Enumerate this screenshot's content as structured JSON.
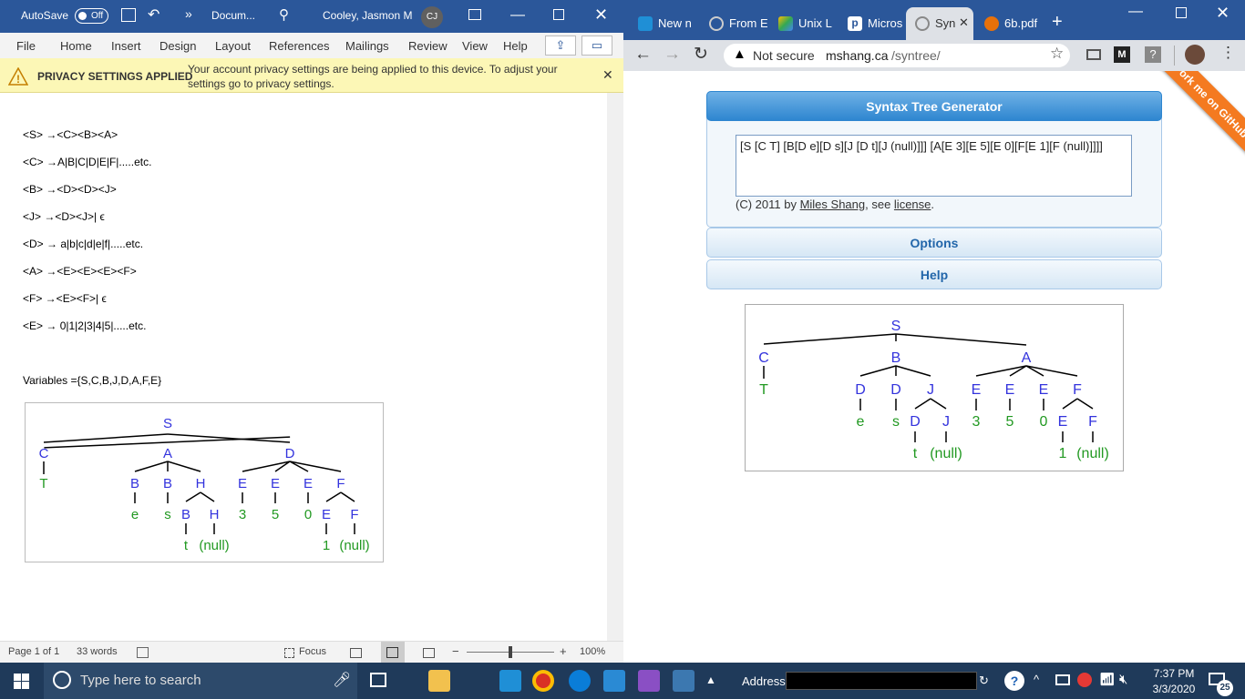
{
  "word": {
    "autosave_label": "AutoSave",
    "autosave_state": "Off",
    "doc_title": "Docum...",
    "user_name": "Cooley, Jasmon M",
    "user_initials": "CJ",
    "menu": [
      "File",
      "Home",
      "Insert",
      "Design",
      "Layout",
      "References",
      "Mailings",
      "Review",
      "View",
      "Help"
    ],
    "privacy_title": "PRIVACY SETTINGS APPLIED",
    "privacy_line1": "Your account privacy settings are being applied to this device. To adjust your",
    "privacy_line2": "settings go to privacy settings.",
    "grammar": [
      "<S> →<C><B><A>",
      "<C> →A|B|C|D|E|F|.....etc.",
      "<B> →<D><D><J>",
      "<J> →<D><J>| ϵ",
      "<D> → a|b|c|d|e|f|.....etc.",
      "<A> →<E><E><E><F>",
      "<F> →<E><F>| ϵ",
      "<E> → 0|1|2|3|4|5|.....etc."
    ],
    "variables": "Variables ={S,C,B,J,D,A,F,E}",
    "tree": {
      "root": "S",
      "level1": [
        "C",
        "A",
        "D"
      ],
      "c_child": "T",
      "a_children": [
        "B",
        "B",
        "H"
      ],
      "d_children": [
        "E",
        "E",
        "E",
        "F"
      ],
      "b_leaves": [
        "e",
        "s"
      ],
      "h_children": [
        "B",
        "H"
      ],
      "e_leaves": [
        "3",
        "5",
        "0"
      ],
      "f_children": [
        "E",
        "F"
      ],
      "deep_leaves": [
        "t",
        "(null)",
        "1",
        "(null)"
      ]
    },
    "status": {
      "page": "Page 1 of 1",
      "words": "33 words",
      "focus": "Focus",
      "zoom": "100%"
    }
  },
  "chrome": {
    "tabs": [
      "New n",
      "From E",
      "Unix L",
      "Micros",
      "Syn",
      "6b.pdf"
    ],
    "new_tab": "+",
    "not_secure": "Not secure",
    "url_host": "mshang.ca",
    "url_path": "/syntree/",
    "page": {
      "title": "Syntax Tree Generator",
      "input_text": "[S [C T] [B[D e][D s][J [D t][J (null)]]] [A[E 3][E 5][E 0][F[E 1][F (null)]]]]",
      "credit_prefix": "(C) 2011 by ",
      "credit_author": "Miles Shang",
      "credit_mid": ", see ",
      "credit_license": "license",
      "credit_end": ".",
      "options_label": "Options",
      "help_label": "Help",
      "ribbon": "Fork me on GitHub"
    },
    "tree": {
      "root": "S",
      "level1": [
        "C",
        "B",
        "A"
      ],
      "c_child": "T",
      "b_children": [
        "D",
        "D",
        "J"
      ],
      "a_children": [
        "E",
        "E",
        "E",
        "F"
      ],
      "d_leaves": [
        "e",
        "s"
      ],
      "j_children": [
        "D",
        "J"
      ],
      "e_leaves": [
        "3",
        "5",
        "0"
      ],
      "f_children": [
        "E",
        "F"
      ],
      "deep_leaves": [
        "t",
        "(null)",
        "1",
        "(null)"
      ]
    }
  },
  "taskbar": {
    "search_placeholder": "Type here to search",
    "address_label": "Address",
    "time": "7:37 PM",
    "date": "3/3/2020",
    "notif_count": "25"
  },
  "colors": {
    "word_blue": "#2b579a",
    "node_blue": "#3333dd",
    "leaf_green": "#229922"
  }
}
